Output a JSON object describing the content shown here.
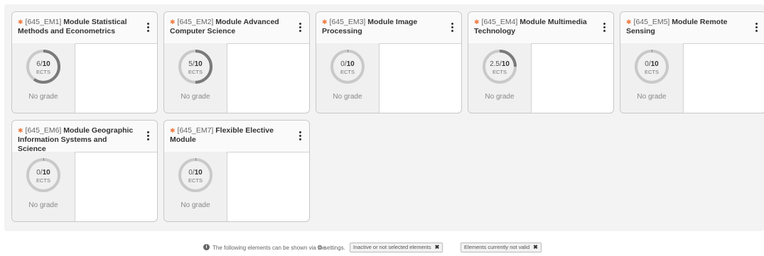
{
  "modules": [
    {
      "code": "[645_EM1]",
      "title": "Module Statistical Methods and Econometrics",
      "earned": "6",
      "total": "10",
      "progress": 0.6,
      "unit": "ECTS",
      "grade": "No grade"
    },
    {
      "code": "[645_EM2]",
      "title": "Module Advanced Computer Science",
      "earned": "5",
      "total": "10",
      "progress": 0.5,
      "unit": "ECTS",
      "grade": "No grade"
    },
    {
      "code": "[645_EM3]",
      "title": "Module Image Processing",
      "earned": "0",
      "total": "10",
      "progress": 0,
      "unit": "ECTS",
      "grade": "No grade"
    },
    {
      "code": "[645_EM4]",
      "title": "Module Multimedia Technology",
      "earned": "2.5",
      "total": "10",
      "progress": 0.25,
      "unit": "ECTS",
      "grade": "No grade"
    },
    {
      "code": "[645_EM5]",
      "title": "Module Remote Sensing",
      "earned": "0",
      "total": "10",
      "progress": 0,
      "unit": "ECTS",
      "grade": "No grade"
    },
    {
      "code": "[645_EM6]",
      "title": "Module Geographic Information Systems and Science",
      "earned": "0",
      "total": "10",
      "progress": 0,
      "unit": "ECTS",
      "grade": "No grade"
    },
    {
      "code": "[645_EM7]",
      "title": "Flexible Elective Module",
      "earned": "0",
      "total": "10",
      "progress": 0,
      "unit": "ECTS",
      "grade": "No grade"
    }
  ],
  "colors": {
    "accent": "#f07b3f",
    "ring_track": "#c9c9c9",
    "ring_fill": "#7a7a7a"
  },
  "footer": {
    "text_before": "The following elements can be shown via the",
    "text_after": "settings.",
    "chips": [
      "Inactive or not selected elements",
      "Elements currently not valid"
    ]
  }
}
